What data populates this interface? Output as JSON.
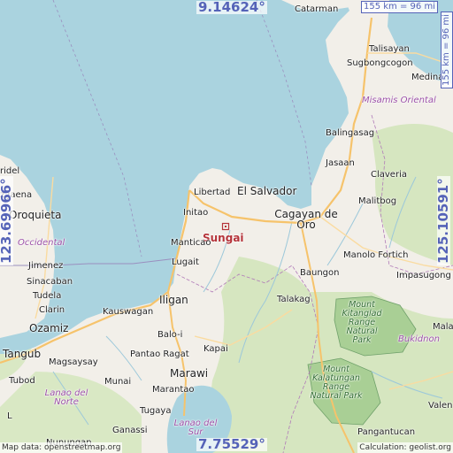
{
  "coords": {
    "top": "9.14624°",
    "bottom": "7.75529°",
    "left": "123.69966°",
    "right": "125.10591°"
  },
  "scale": {
    "top": "155 km = 96 mi",
    "right": "155 km = 96 mi"
  },
  "target": {
    "name": "Sungai"
  },
  "places": {
    "catarman": "Catarman",
    "talisayan": "Talisayan",
    "sugbongcogon": "Sugbongcogon",
    "medina": "Medina",
    "misamis_oriental": "Misamis Oriental",
    "balingasag": "Balingasag",
    "jasaan": "Jasaan",
    "claveria": "Claveria",
    "malitbog": "Malitbog",
    "el_salvador": "El Salvador",
    "libertad": "Libertad",
    "cagayan_de_oro": "Cagayan de Oro",
    "initao": "Initao",
    "manticao": "Manticao",
    "lugait": "Lugait",
    "manolo_fortich": "Manolo Fortich",
    "baungon": "Baungon",
    "impasugong": "Impasugong",
    "talakag": "Talakag",
    "kitanglad": "Mount Kitanglad Range Natural Park",
    "bukidnon": "Bukidnon",
    "iligan": "Iligan",
    "kauswagan": "Kauswagan",
    "balo_i": "Balo-i",
    "pantao_ragat": "Pantao Ragat",
    "kapai": "Kapai",
    "marawi": "Marawi",
    "marantao": "Marantao",
    "tugaya": "Tugaya",
    "ganassi": "Ganassi",
    "nunungan": "Nunungan",
    "lake_lanao": "Lanao del Sur",
    "lanao_norte": "Lanao del Norte",
    "kalatungan": "Mount Kalatungan Range Natural Park",
    "pangantucan": "Pangantucan",
    "valencia": "Valen",
    "mala": "Mala",
    "dipolog_frag": "ridel",
    "jaena": "z Jaena",
    "oroquieta": "Oroquieta",
    "occidental": "Occidental",
    "jimenez": "Jimenez",
    "sinacaban": "Sinacaban",
    "tudela": "Tudela",
    "clarin": "Clarin",
    "ozamiz": "Ozamiz",
    "tangub": "Tangub",
    "magsaysay": "Magsaysay",
    "munai": "Munai",
    "tubod": "Tubod",
    "l_frag": "L"
  },
  "footer": {
    "left": "Map data: openstreetmap.org",
    "right": "Calculation: geolist.org"
  },
  "colors": {
    "water": "#aad3df",
    "land": "#f2efe9",
    "forest": "#c9dfb0",
    "park": "#a9cf95",
    "coord": "#5563b8",
    "target": "#b5343a",
    "region": "#9b4fa6"
  }
}
